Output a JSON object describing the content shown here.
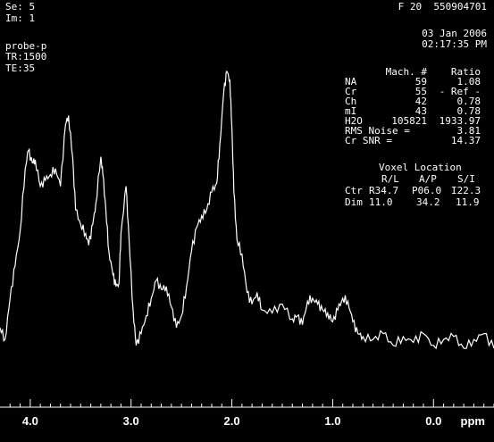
{
  "header": {
    "series": "Se: 5",
    "image": "Im: 1",
    "frame_id": "F 20  550904701",
    "date": "03 Jan 2006",
    "time": "02:17:35 PM",
    "probe": "probe-p",
    "tr": "TR:1500",
    "te": "TE:35"
  },
  "metabolites": {
    "header_mach": "Mach. #",
    "header_ratio": "Ratio",
    "rows": [
      {
        "name": "NA",
        "mach": "59",
        "ratio": "1.08"
      },
      {
        "name": "Cr",
        "mach": "55",
        "ratio": "- Ref -"
      },
      {
        "name": "Ch",
        "mach": "42",
        "ratio": "0.78"
      },
      {
        "name": "mI",
        "mach": "43",
        "ratio": "0.78"
      },
      {
        "name": "H2O",
        "mach": "105821",
        "ratio": "1933.97"
      }
    ],
    "rms_noise_label": "RMS Noise  =",
    "rms_noise_value": "3.81",
    "cr_snr_label": "Cr SNR     =",
    "cr_snr_value": "14.37"
  },
  "voxel": {
    "title": "Voxel Location",
    "headers": [
      "R/L",
      "A/P",
      "S/I"
    ],
    "ctr_label": "Ctr",
    "ctr": [
      "R34.7",
      "P06.0",
      "I22.3"
    ],
    "dim_label": "Dim",
    "dim": [
      "11.0",
      "34.2",
      "11.9"
    ]
  },
  "chart_data": {
    "type": "line",
    "xlabel": "ppm",
    "x_reversed": true,
    "xlim": [
      4.3,
      -0.6
    ],
    "ylim": [
      0,
      1
    ],
    "ticks": [
      {
        "value": 4.0,
        "label": "4.0"
      },
      {
        "value": 3.0,
        "label": "3.0"
      },
      {
        "value": 2.0,
        "label": "2.0"
      },
      {
        "value": 1.0,
        "label": "1.0"
      },
      {
        "value": 0.0,
        "label": "0.0"
      }
    ],
    "series": [
      {
        "x": [
          4.3,
          4.25,
          4.2,
          4.15,
          4.1,
          4.05,
          4.02,
          3.98,
          3.95,
          3.9,
          3.85,
          3.8,
          3.75,
          3.7,
          3.65,
          3.62,
          3.58,
          3.55,
          3.5,
          3.45,
          3.42,
          3.38,
          3.35,
          3.3,
          3.28,
          3.25,
          3.22,
          3.18,
          3.15,
          3.12,
          3.1,
          3.05,
          3.02,
          2.98,
          2.95,
          2.9,
          2.85,
          2.8,
          2.75,
          2.7,
          2.65,
          2.6,
          2.55,
          2.5,
          2.45,
          2.4,
          2.35,
          2.3,
          2.25,
          2.2,
          2.15,
          2.12,
          2.08,
          2.05,
          2.02,
          2.0,
          1.98,
          1.95,
          1.9,
          1.85,
          1.8,
          1.75,
          1.7,
          1.6,
          1.5,
          1.4,
          1.35,
          1.3,
          1.25,
          1.2,
          1.15,
          1.1,
          1.05,
          1.0,
          0.95,
          0.9,
          0.85,
          0.8,
          0.75,
          0.7,
          0.6,
          0.5,
          0.4,
          0.3,
          0.2,
          0.1,
          0.0,
          -0.1,
          -0.2,
          -0.3,
          -0.4,
          -0.5,
          -0.6
        ],
        "y": [
          0.1,
          0.06,
          0.2,
          0.31,
          0.43,
          0.64,
          0.7,
          0.66,
          0.67,
          0.58,
          0.6,
          0.62,
          0.64,
          0.58,
          0.79,
          0.82,
          0.68,
          0.5,
          0.45,
          0.42,
          0.38,
          0.45,
          0.52,
          0.68,
          0.62,
          0.5,
          0.36,
          0.28,
          0.24,
          0.25,
          0.42,
          0.58,
          0.4,
          0.16,
          0.04,
          0.08,
          0.14,
          0.2,
          0.26,
          0.23,
          0.24,
          0.17,
          0.1,
          0.14,
          0.24,
          0.36,
          0.44,
          0.48,
          0.5,
          0.56,
          0.59,
          0.72,
          0.9,
          0.97,
          0.94,
          0.78,
          0.56,
          0.4,
          0.35,
          0.22,
          0.18,
          0.22,
          0.16,
          0.15,
          0.18,
          0.13,
          0.14,
          0.11,
          0.19,
          0.2,
          0.18,
          0.16,
          0.15,
          0.12,
          0.16,
          0.2,
          0.19,
          0.12,
          0.08,
          0.07,
          0.06,
          0.08,
          0.04,
          0.07,
          0.05,
          0.08,
          0.04,
          0.06,
          0.07,
          0.03,
          0.06,
          0.08,
          0.03
        ]
      }
    ]
  }
}
